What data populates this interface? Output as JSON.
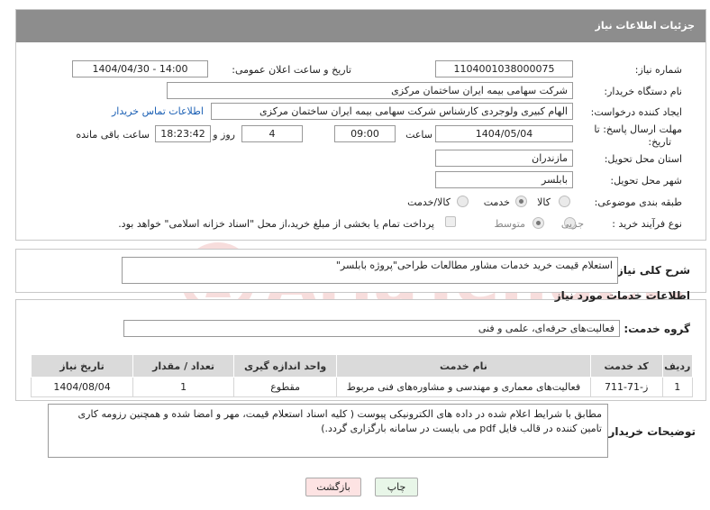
{
  "header": {
    "title": "جزئیات اطلاعات نیاز"
  },
  "form": {
    "need_number_label": "شماره نیاز:",
    "need_number": "1104001038000075",
    "announce_label": "تاریخ و ساعت اعلان عمومی:",
    "announce_value": "1404/04/30 - 14:00",
    "buyer_org_label": "نام دستگاه خریدار:",
    "buyer_org": "شرکت سهامی بیمه ایران ساختمان مرکزی",
    "creator_label": "ایجاد کننده درخواست:",
    "creator": "الهام کبیری ولوجردی کارشناس شرکت سهامی بیمه ایران ساختمان مرکزی",
    "contact_link": "اطلاعات تماس خریدار",
    "deadline_label_1": "مهلت ارسال پاسخ: تا",
    "deadline_label_2": "تاریخ:",
    "deadline_date": "1404/05/04",
    "time_label": "ساعت",
    "deadline_time": "09:00",
    "days_value": "4",
    "days_label": "روز و",
    "remaining_time": "18:23:42",
    "remaining_label": "ساعت باقی مانده",
    "province_label": "استان محل تحویل:",
    "province": "مازندران",
    "city_label": "شهر محل تحویل:",
    "city": "بابلسر",
    "category_label": "طبقه بندی موضوعی:",
    "category_options": [
      "کالا",
      "خدمت",
      "کالا/خدمت"
    ],
    "process_label": "نوع فرآیند خرید :",
    "process_options": [
      "جزیی",
      "متوسط"
    ],
    "payment_note": "پرداخت تمام یا بخشی از مبلغ خرید،از محل \"اسناد خزانه اسلامی\" خواهد بود."
  },
  "summary": {
    "label": "شرح کلی نیاز:",
    "value": "استعلام قیمت خرید خدمات مشاور مطالعات طراحی\"پروژه بابلسر\""
  },
  "services": {
    "section_title": "اطلاعات خدمات مورد نیاز",
    "group_label": "گروه خدمت:",
    "group_value": "فعالیت‌های حرفه‌ای، علمی و فنی",
    "table": {
      "headers": [
        "ردیف",
        "کد خدمت",
        "نام خدمت",
        "واحد اندازه گیری",
        "تعداد / مقدار",
        "تاریخ نیاز"
      ],
      "rows": [
        [
          "1",
          "ز-71-711",
          "فعالیت‌های معماری و مهندسی و مشاوره‌های فنی مربوط",
          "مقطوع",
          "1",
          "1404/08/04"
        ]
      ]
    }
  },
  "notes": {
    "label": "توضیحات خریدار:",
    "value": "مطابق با شرایط اعلام شده در داده های الکترونیکی پیوست ( کلیه اسناد استعلام قیمت، مهر و امضا شده و همچنین رزومه کاری تامین کننده در قالب فایل pdf می بایست در سامانه بارگزاری گردد.)"
  },
  "buttons": {
    "print": "چاپ",
    "back": "بازگشت"
  },
  "watermark": {
    "text": "AriaTender.neT"
  },
  "colors": {
    "header_bg": "#8d8d8d",
    "link": "#1a5fb4",
    "back_btn": "#fde3e3",
    "print_btn": "#e8f6e8",
    "watermark": "#d0342c"
  }
}
